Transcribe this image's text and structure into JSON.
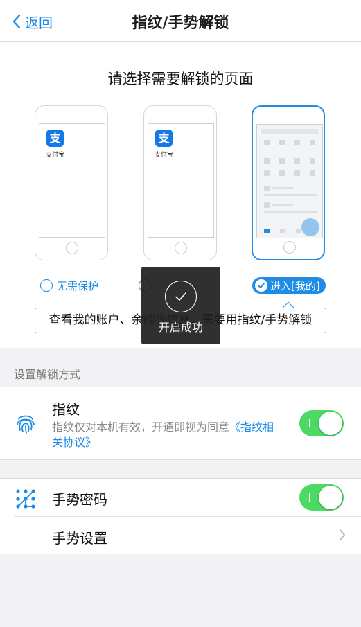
{
  "nav": {
    "back_label": "返回",
    "title": "指纹/手势解锁"
  },
  "select": {
    "title": "请选择需要解锁的页面",
    "app_logo": "支",
    "app_name": "支付宝",
    "options": [
      {
        "label": "无需保护",
        "selected": false
      },
      {
        "label": "",
        "selected": false
      },
      {
        "label": "进入[我的]",
        "selected": true
      }
    ],
    "description": "查看我的账户、余额等信息，需要用指纹/手势解锁"
  },
  "toast": {
    "text": "开启成功"
  },
  "section": {
    "label": "设置解锁方式"
  },
  "fingerprint": {
    "title": "指纹",
    "desc_prefix": "指纹仅对本机有效，开通即视为同意",
    "desc_link": "《指纹相关协议》",
    "enabled": true
  },
  "gesture": {
    "title": "手势密码",
    "enabled": true,
    "settings_label": "手势设置"
  },
  "colors": {
    "accent": "#1a8ae5",
    "toggle_on": "#4cd964",
    "toast_bg": "#1e1e1e"
  }
}
